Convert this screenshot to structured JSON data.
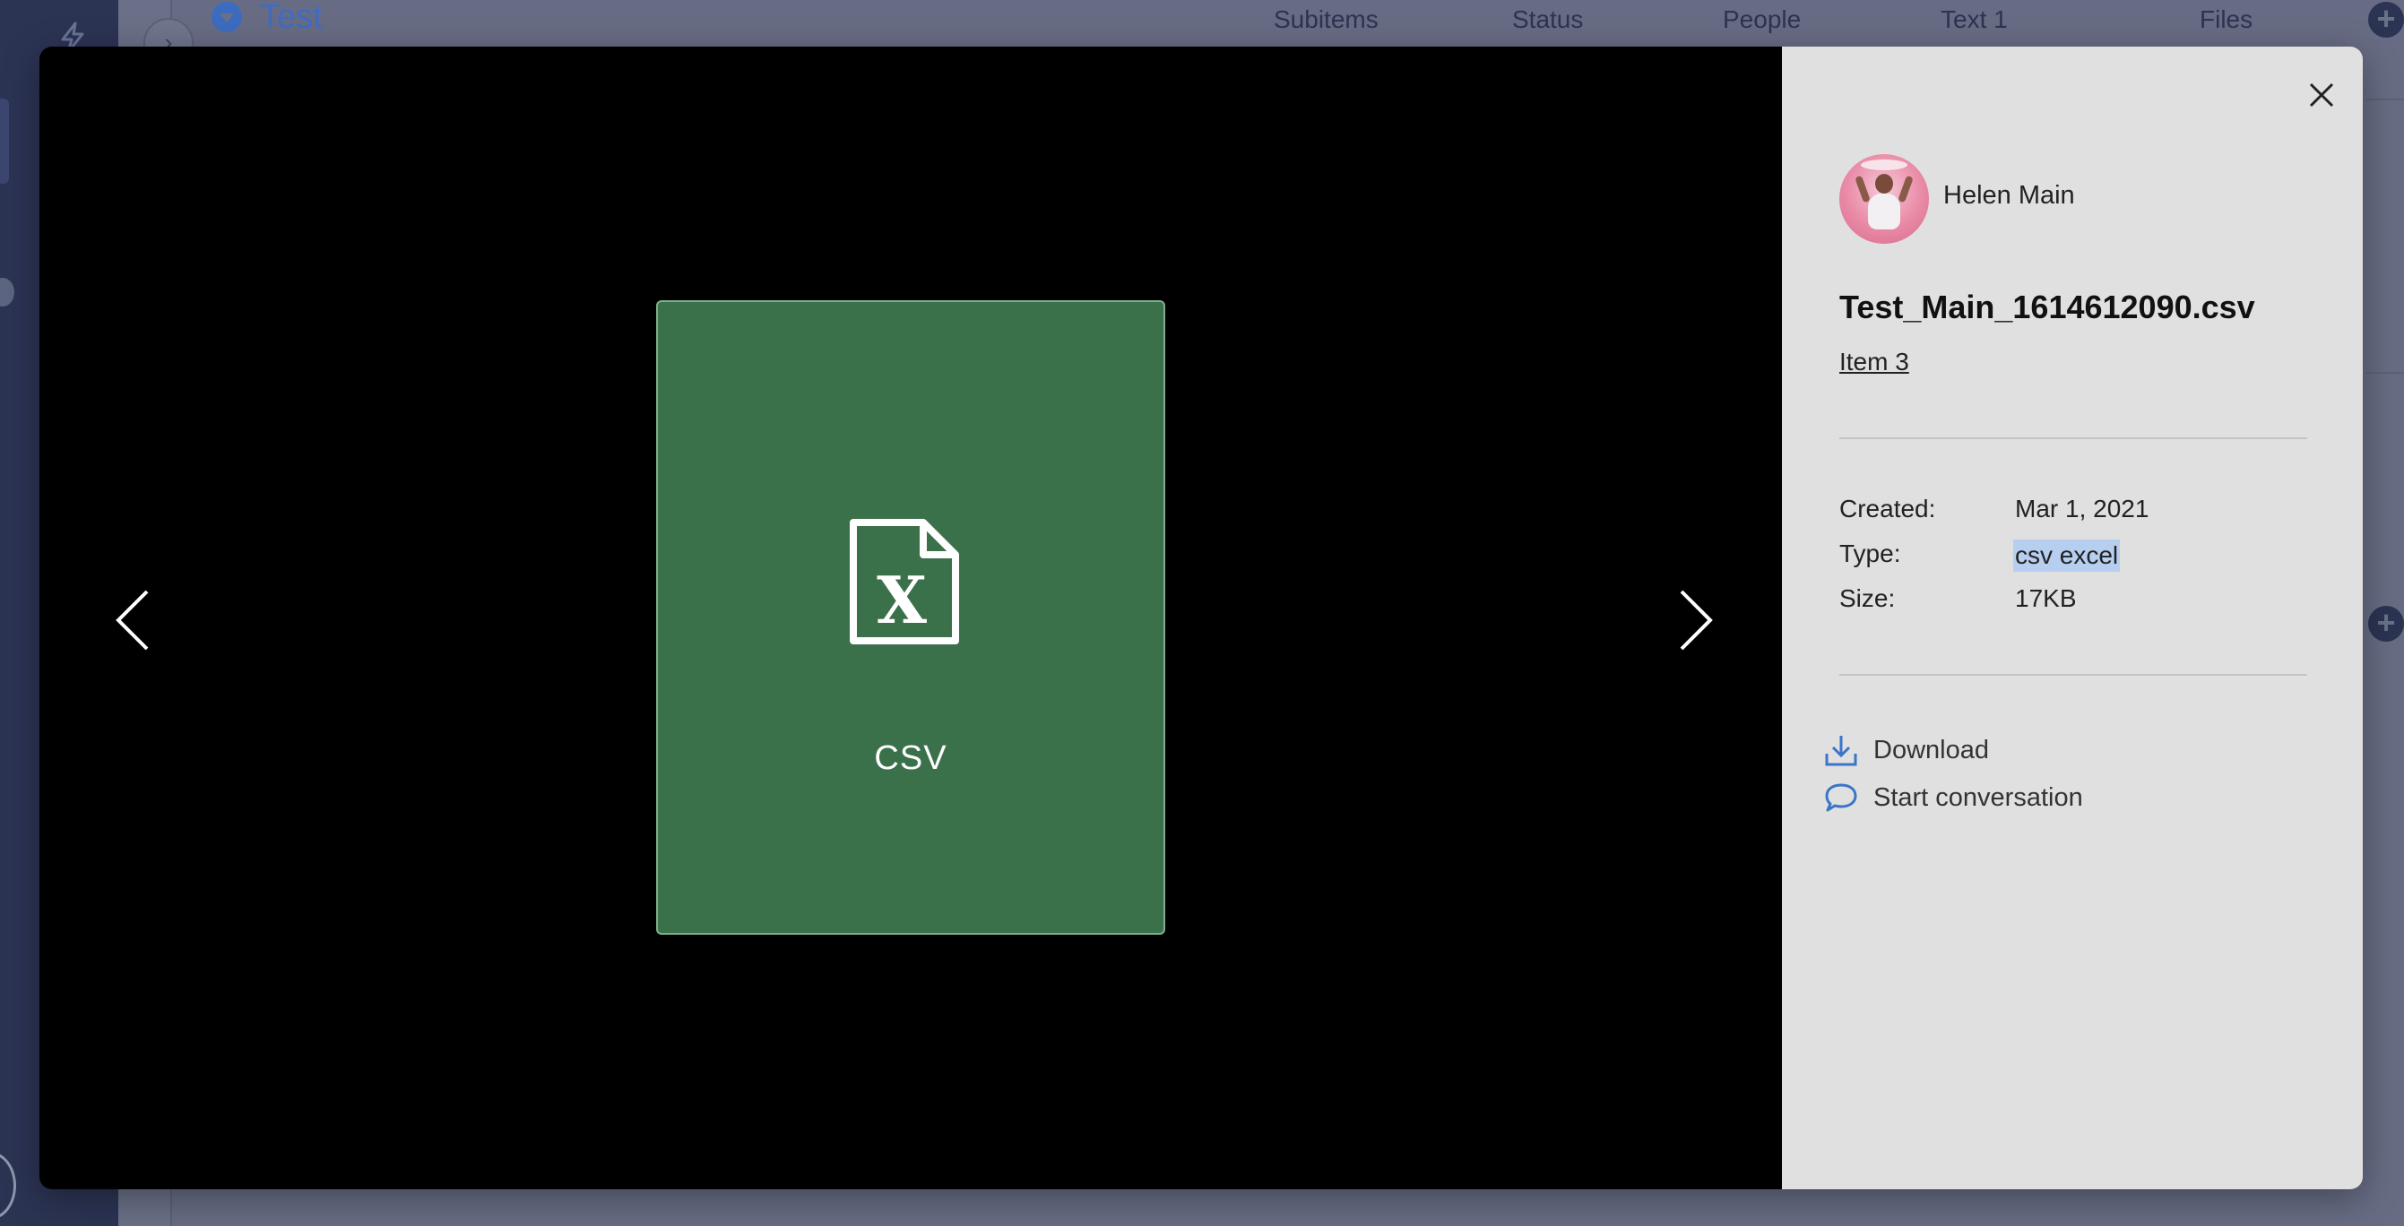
{
  "background": {
    "group_title": "Test",
    "columns": [
      "Subitems",
      "Status",
      "People",
      "Text 1",
      "Files"
    ]
  },
  "viewer": {
    "file_kind": "CSV",
    "card_color": "#3b714a",
    "prev_icon": "chevron-left-icon",
    "next_icon": "chevron-right-icon"
  },
  "info": {
    "user_name": "Helen Main",
    "file_name": "Test_Main_1614612090.csv",
    "item_link": "Item 3",
    "meta": {
      "created_label": "Created:",
      "created_value": "Mar 1, 2021",
      "type_label": "Type:",
      "type_value": "csv excel",
      "size_label": "Size:",
      "size_value": "17KB"
    },
    "actions": {
      "download": "Download",
      "start_conversation": "Start conversation"
    },
    "accent_color": "#3b74c8"
  }
}
